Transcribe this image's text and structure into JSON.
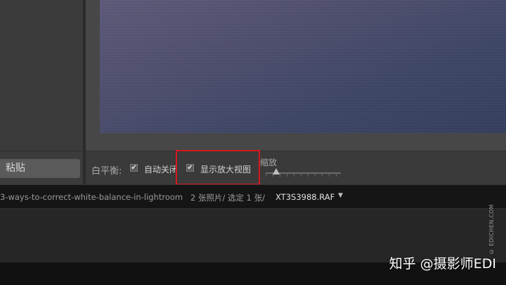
{
  "left_panel": {
    "paste_label": "粘贴"
  },
  "toolbar": {
    "white_balance_label": "白平衡:",
    "auto_dismiss_label": "自动关闭",
    "show_loupe_label": "显示放大视图",
    "zoom_label": "缩放",
    "auto_dismiss_checked": true,
    "show_loupe_checked": true,
    "check_glyph": "✔"
  },
  "filmstrip": {
    "path": "3-ways-to-correct-white-balance-in-lightroom",
    "count": "2 张照片/ 选定 1 张/",
    "filename": "XT3S3988.RAF",
    "caret": "▼"
  },
  "watermark": {
    "vertical": "© EDICHEN.COM",
    "main": "知乎 @摄影师EDI"
  },
  "colors": {
    "highlight_box": "#d7181f"
  }
}
